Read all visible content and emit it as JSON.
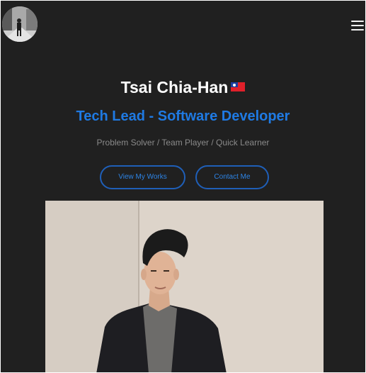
{
  "header": {
    "avatar_icon": "profile-avatar",
    "menu_icon": "hamburger-menu-icon"
  },
  "hero": {
    "name": "Tsai Chia-Han",
    "flag_icon": "taiwan-flag-icon",
    "role": "Tech Lead - Software Developer",
    "tagline": "Problem Solver / Team Player / Quick Learner"
  },
  "actions": {
    "view_works": "View My Works",
    "contact": "Contact Me"
  },
  "colors": {
    "background": "#202020",
    "accent": "#1f7ae3",
    "button_border": "#1f5fb8",
    "muted_text": "#8a8a8a"
  }
}
